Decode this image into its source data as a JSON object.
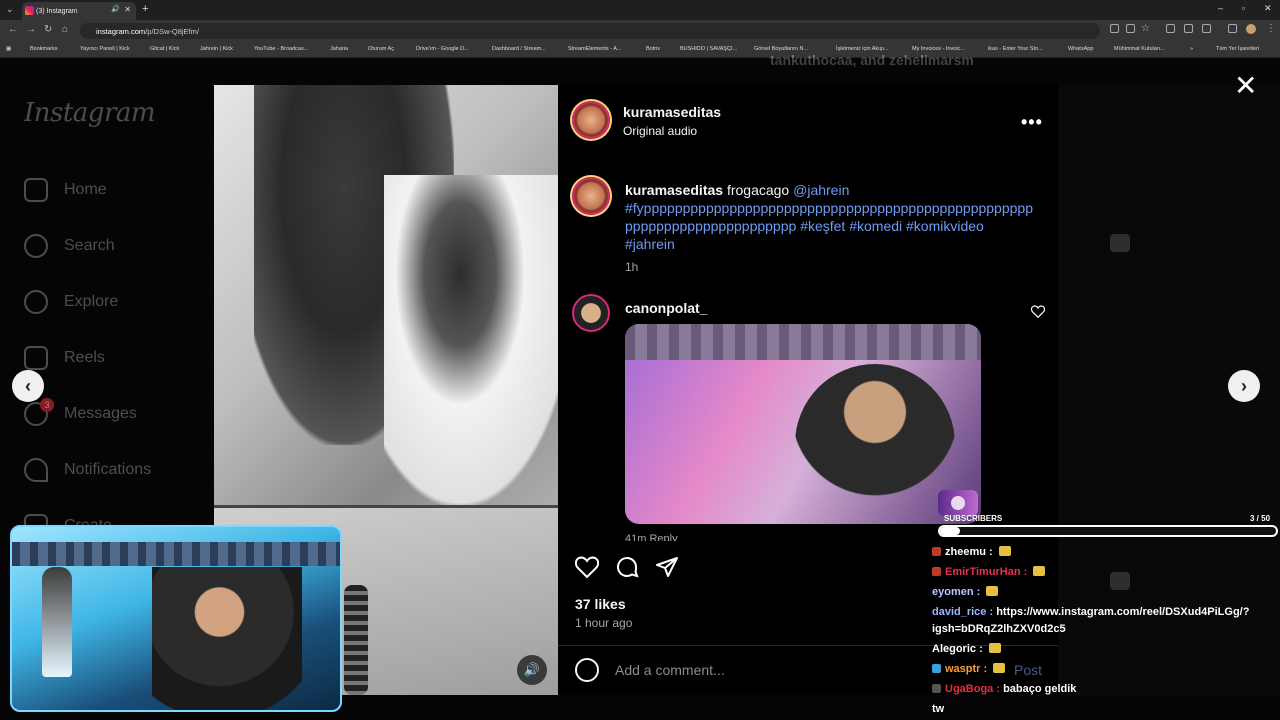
{
  "browser": {
    "tab_title": "(3) Instagram",
    "url_prefix": "instagram.com",
    "url_path": "/p/DSw-Q8jEfm/",
    "bookmarks": [
      "Bookmarks",
      "Yayıncı Paneli | Kick",
      "Gitcat | Kick",
      "Jahrein | Kick",
      "YouTube - Broadcas...",
      "Jaharia",
      "Oturum Aç",
      "Drive'ım - Google D...",
      "Dashboard / Stream...",
      "StreamElements - A...",
      "Botrix",
      "BUSHIDO | SAVAŞÇI...",
      "Görsel Boyutlarını N...",
      "İşletmeniz için Akışı...",
      "My Invoices - Invoic...",
      "ikas - Enter Your Sto...",
      "WhatsApp",
      "Mühimmat Kutuları..."
    ],
    "all_bookmarks": "Tüm Yer İşaretleri",
    "new_tab": "+"
  },
  "instagram": {
    "logo": "Instagram",
    "nav": [
      {
        "label": "Home"
      },
      {
        "label": "Search"
      },
      {
        "label": "Explore"
      },
      {
        "label": "Reels"
      },
      {
        "label": "Messages",
        "badge": "3"
      },
      {
        "label": "Notifications"
      },
      {
        "label": "Create"
      }
    ],
    "bg_username_text": "tankuthocaa, and zehelimarsm"
  },
  "post": {
    "author": "kuramaseditas",
    "audio": "Original audio",
    "caption_user": "kuramaseditas",
    "caption_text": "frogacago",
    "caption_mention": "@jahrein",
    "caption_tags_1": "#fypppppppppppppppppppppppppppppppppppppppppppppppppp",
    "caption_tags_2": "pppppppppppppppppppppp",
    "caption_tags_3": "#keşfet #komedi #komikvideo",
    "caption_tags_4": "#jahrein",
    "caption_time": "1h",
    "comment_user": "canonpolat_",
    "comment_meta": "41m   Reply",
    "likes": "37 likes",
    "posted": "1 hour ago",
    "comment_placeholder": "Add a comment...",
    "post_label": "Post",
    "more_label": "•••"
  },
  "stream": {
    "subscribers_label": "SUBSCRIBERS",
    "subscribers_count": "3 / 50",
    "subscribers_fraction": 0.06,
    "chat": [
      {
        "user": "zheemu",
        "color": "#ffffff",
        "msg": "",
        "badge": "#c0392b"
      },
      {
        "user": "EmirTimurHan",
        "color": "#e0315a",
        "msg": "",
        "badge": "#c0392b"
      },
      {
        "user": "eyomen",
        "color": "#b8c4ff",
        "msg": "",
        "badge": ""
      },
      {
        "user": "david_rice",
        "color": "#9ab8ff",
        "msg": "https://www.instagram.com/reel/DSXud4PiLGg/?",
        "badge": ""
      },
      {
        "user": "",
        "color": "#ffffff",
        "msg": "igsh=bDRqZ2lhZXV0d2c5",
        "badge": ""
      },
      {
        "user": "Alegoric",
        "color": "#ffffff",
        "msg": "",
        "badge": ""
      },
      {
        "user": "wasptr",
        "color": "#ff9a3c",
        "msg": "",
        "badge": "#3aa0e0"
      },
      {
        "user": "UgaBoga",
        "color": "#e03040",
        "msg": "babaço geldik",
        "badge": "#555"
      },
      {
        "user": "",
        "color": "#ffffff",
        "msg": "tw",
        "badge": ""
      }
    ]
  }
}
